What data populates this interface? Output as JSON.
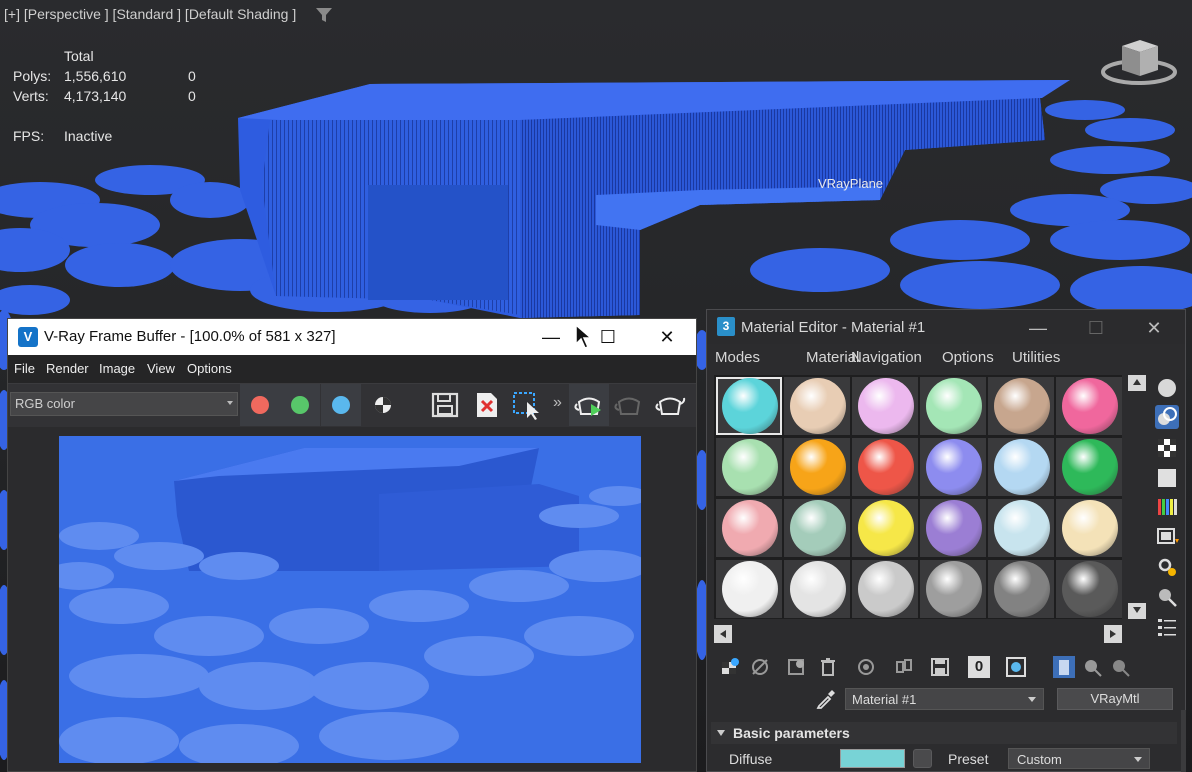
{
  "viewport": {
    "label": "[+] [Perspective ] [Standard ] [Default Shading ]",
    "stats": {
      "header": "Total",
      "rows": [
        {
          "key": "Polys:",
          "value": "1,556,610",
          "sel": "0"
        },
        {
          "key": "Verts:",
          "value": "4,173,140",
          "sel": "0"
        }
      ],
      "fps_key": "FPS:",
      "fps_value": "Inactive"
    },
    "object_label": "VRayPlane",
    "scene_color": "#2f5fe0"
  },
  "vfb": {
    "app_icon": "V",
    "title": "V-Ray Frame Buffer - [100.0% of 581 x 327]",
    "menu": [
      "File",
      "Render",
      "Image",
      "View",
      "Options"
    ],
    "channel_select": "RGB color",
    "channels": [
      {
        "name": "red-channel",
        "color": "#f0695e"
      },
      {
        "name": "green-channel",
        "color": "#58c76a"
      },
      {
        "name": "blue-channel",
        "color": "#5ab8ee"
      }
    ],
    "render_color": "#3a6fe6"
  },
  "material_editor": {
    "app_icon": "3",
    "title": "Material Editor - Material #1",
    "menu": [
      "Modes",
      "Material",
      "Navigation",
      "Options",
      "Utilities"
    ],
    "slots": [
      [
        "#5cd4da",
        "#e8cdb4",
        "#ecb8ee",
        "#a4e6b6",
        "#c7a68e",
        "#f0679d"
      ],
      [
        "#a8e0b0",
        "#f7a418",
        "#ee5648",
        "#8d8cef",
        "#b4d8f2",
        "#2eb95a"
      ],
      [
        "#f0aab0",
        "#a4ccba",
        "#f6e748",
        "#9b7ed4",
        "#c8e4ee",
        "#f4e2b8"
      ],
      [
        "#f0f0f0",
        "#e4e4e4",
        "#cacaca",
        "#9e9e9e",
        "#828282",
        "#5a5a5a"
      ]
    ],
    "material_name": "Material #1",
    "material_type": "VRayMtl",
    "rollout_title": "Basic parameters",
    "diffuse_label": "Diffuse",
    "diffuse_color": "#78d3d6",
    "preset_label": "Preset",
    "preset_value": "Custom"
  }
}
